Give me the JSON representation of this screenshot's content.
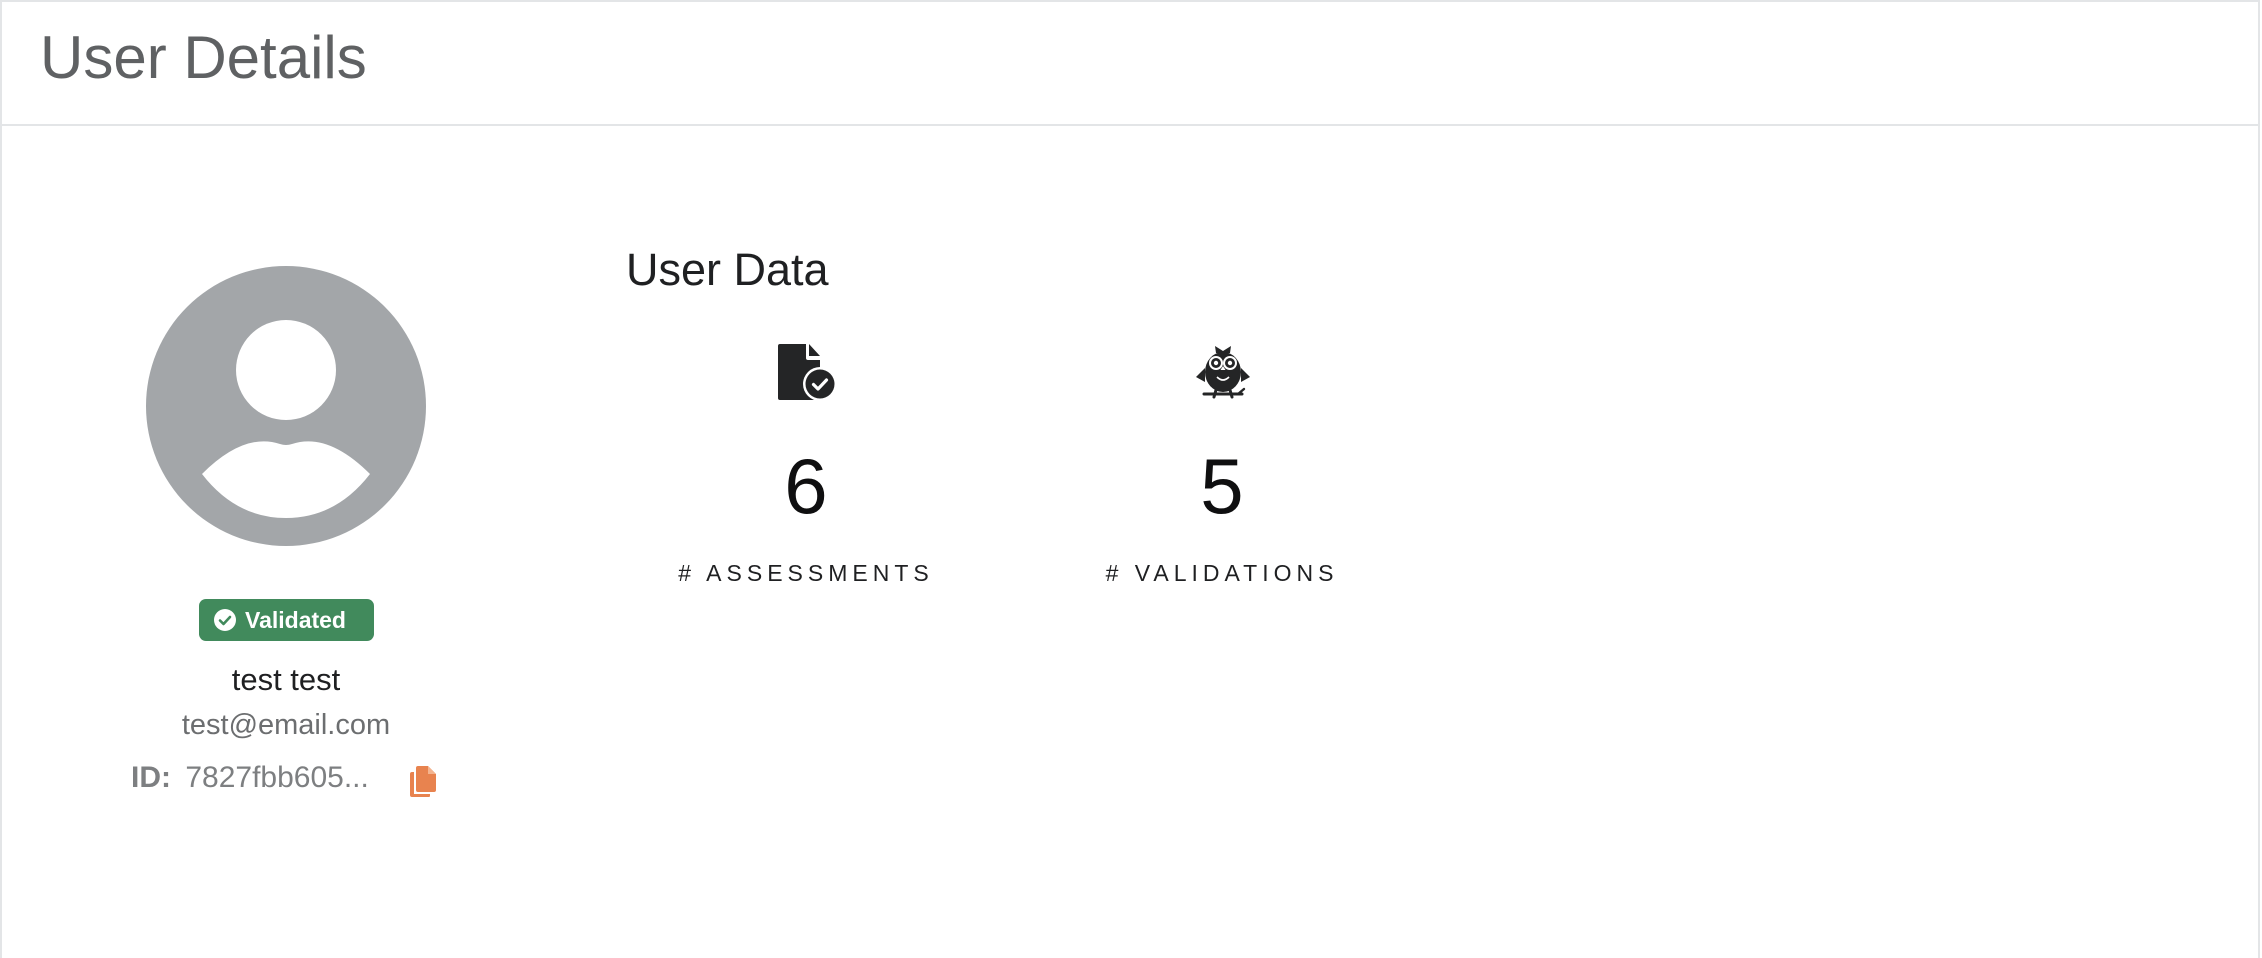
{
  "header": {
    "title": "User Details"
  },
  "profile": {
    "avatar_icon": "default-user-avatar",
    "status_badge": "Validated",
    "status_color": "#418a5c",
    "name": "test test",
    "email": "test@email.com",
    "id_label": "ID:",
    "id_value": "7827fbb605...",
    "copy_icon": "copy-icon",
    "copy_color": "#e8834f"
  },
  "user_data": {
    "title": "User Data",
    "stats": [
      {
        "icon": "file-check-icon",
        "value": "6",
        "label": "# ASSESSMENTS"
      },
      {
        "icon": "owl-icon",
        "value": "5",
        "label": "# VALIDATIONS"
      }
    ]
  }
}
